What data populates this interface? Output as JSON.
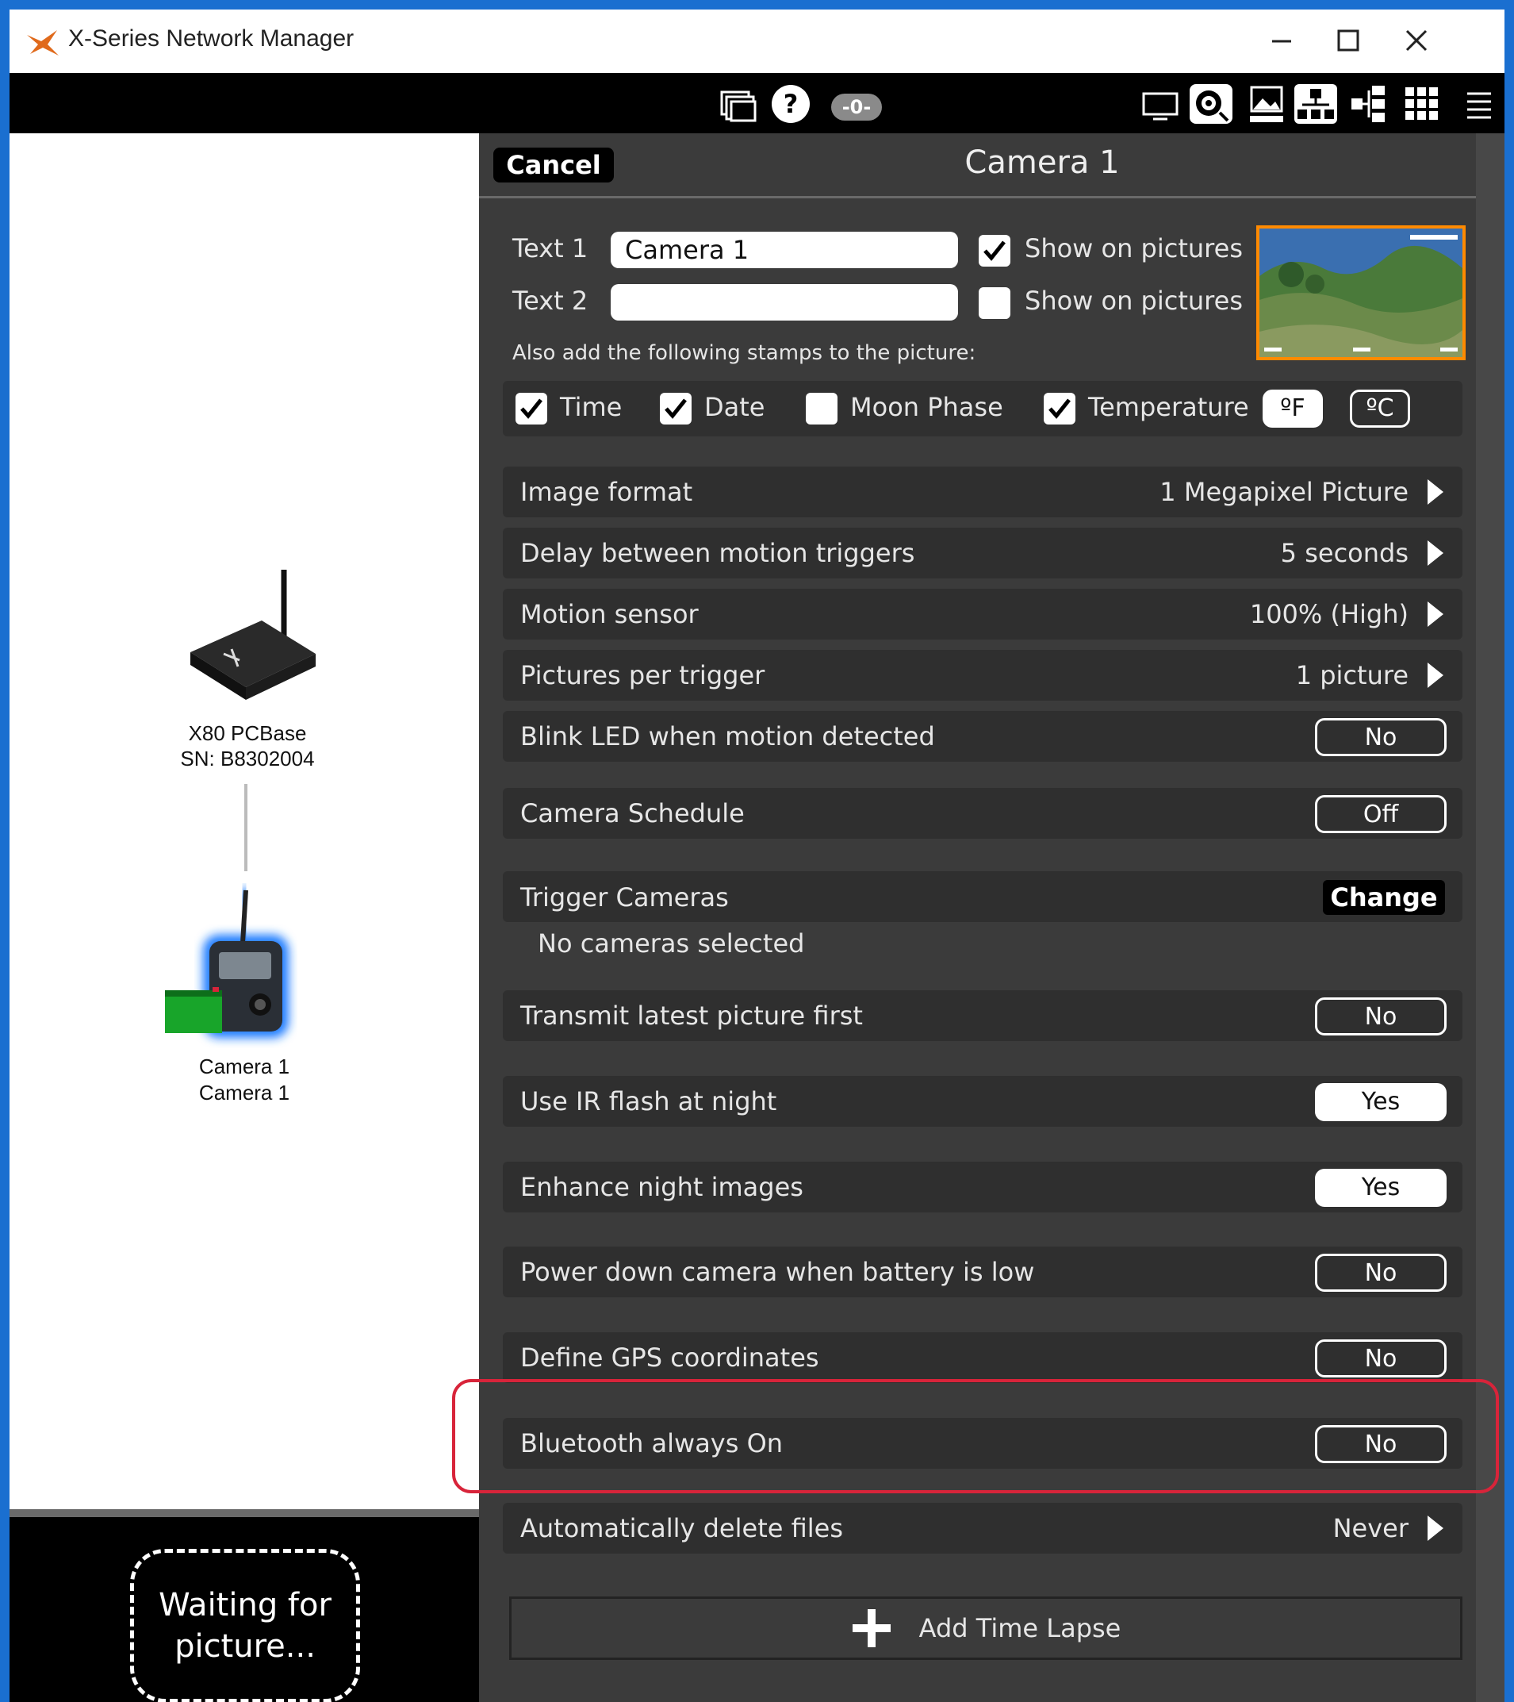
{
  "window": {
    "title": "X-Series Network Manager",
    "controls": [
      "minimize-icon",
      "maximize-icon",
      "close-icon"
    ]
  },
  "toolbar": {
    "message_count": "-0-",
    "icons": [
      "windows-icon",
      "help-icon",
      "monitor-icon",
      "camera-settings-icon",
      "pictures-icon",
      "network-icon",
      "tree-icon",
      "grid-icon",
      "menu-icon"
    ]
  },
  "network": {
    "base": {
      "name": "X80 PCBase",
      "serial": "SN: B8302004"
    },
    "camera": {
      "line1": "Camera 1",
      "line2": "Camera 1"
    },
    "waiting_text": "Waiting for picture..."
  },
  "panel": {
    "cancel_label": "Cancel",
    "title": "Camera 1",
    "text1": {
      "label": "Text 1",
      "value": "Camera 1",
      "show_label": "Show on pictures",
      "show": true
    },
    "text2": {
      "label": "Text 2",
      "value": "",
      "show_label": "Show on pictures",
      "show": false
    },
    "stamps_intro": "Also add the following stamps to the picture:",
    "stamps": [
      {
        "label": "Time",
        "checked": true
      },
      {
        "label": "Date",
        "checked": true
      },
      {
        "label": "Moon Phase",
        "checked": false
      },
      {
        "label": "Temperature",
        "checked": true
      }
    ],
    "units": {
      "f": "ºF",
      "c": "ºC",
      "selected": "ºF"
    },
    "settings": [
      {
        "label": "Image format",
        "value": "1 Megapixel Picture",
        "kind": "arrow"
      },
      {
        "label": "Delay between motion triggers",
        "value": "5 seconds",
        "kind": "arrow"
      },
      {
        "label": "Motion sensor",
        "value": "100% (High)",
        "kind": "arrow"
      },
      {
        "label": "Pictures per trigger",
        "value": "1 picture",
        "kind": "arrow"
      },
      {
        "label": "Blink LED when motion detected",
        "value": "No",
        "kind": "toggle"
      },
      {
        "label": "Camera Schedule",
        "value": "Off",
        "kind": "toggle"
      },
      {
        "label": "Transmit latest picture first",
        "value": "No",
        "kind": "toggle"
      },
      {
        "label": "Use IR flash at night",
        "value": "Yes",
        "kind": "toggle"
      },
      {
        "label": "Enhance night images",
        "value": "Yes",
        "kind": "toggle"
      },
      {
        "label": "Power down camera when battery is low",
        "value": "No",
        "kind": "toggle"
      },
      {
        "label": "Define GPS coordinates",
        "value": "No",
        "kind": "toggle"
      },
      {
        "label": "Bluetooth always On",
        "value": "No",
        "kind": "toggle"
      },
      {
        "label": "Automatically delete files",
        "value": "Never",
        "kind": "arrow"
      }
    ],
    "trigger": {
      "label": "Trigger Cameras",
      "button": "Change",
      "sub": "No cameras selected"
    },
    "add_timelapse": "Add Time Lapse"
  },
  "colors": {
    "highlight": "#d8243a",
    "thumbnail_border": "#ff8a00",
    "panel_bg": "#3b3b3b",
    "row_bg": "#2f2f2f"
  }
}
